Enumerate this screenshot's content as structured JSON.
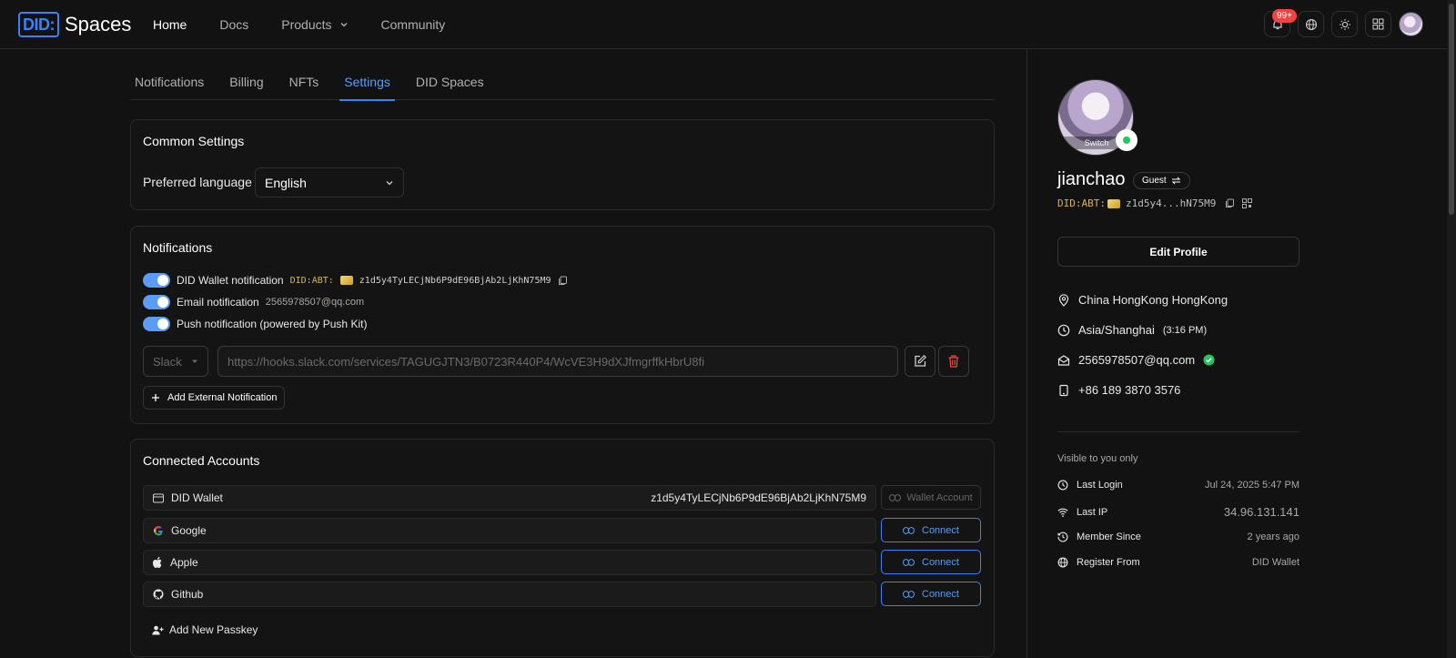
{
  "header": {
    "logo_box": "DID:",
    "logo_text": "Spaces",
    "nav": [
      {
        "label": "Home"
      },
      {
        "label": "Docs"
      },
      {
        "label": "Products"
      },
      {
        "label": "Community"
      }
    ],
    "badge": "99+"
  },
  "tabs": [
    {
      "label": "Notifications"
    },
    {
      "label": "Billing"
    },
    {
      "label": "NFTs"
    },
    {
      "label": "Settings"
    },
    {
      "label": "DID Spaces"
    }
  ],
  "common": {
    "title": "Common Settings",
    "language_label": "Preferred language",
    "language_value": "English"
  },
  "notifications": {
    "title": "Notifications",
    "wallet_label": "DID Wallet notification",
    "did_prefix": "DID:ABT:",
    "did_full": "z1d5y4TyLECjNb6P9dE96BjAb2LjKhN75M9",
    "email_label": "Email notification",
    "email_value": "2565978507@qq.com",
    "push_label": "Push notification (powered by Push Kit)",
    "channel": "Slack",
    "webhook_placeholder": "https://hooks.slack.com/services/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",
    "add_label": "Add External Notification"
  },
  "accounts": {
    "title": "Connected Accounts",
    "rows": [
      {
        "name": "DID Wallet",
        "value": "z1d5y4TyLECjNb6P9dE96BjAb2LjKhN75M9",
        "action": "Wallet Account"
      },
      {
        "name": "Google",
        "action": "Connect"
      },
      {
        "name": "Apple",
        "action": "Connect"
      },
      {
        "name": "Github",
        "action": "Connect"
      }
    ],
    "add_passkey": "Add New Passkey"
  },
  "profile": {
    "switch_label": "Switch",
    "username": "jianchao",
    "role": "Guest",
    "did_prefix": "DID:ABT:",
    "did_short": "z1d5y4...hN75M9",
    "edit_label": "Edit Profile",
    "location": "China HongKong HongKong",
    "timezone": "Asia/Shanghai",
    "local_time": "(3:16 PM)",
    "email": "2565978507@qq.com",
    "phone": "+86 189 3870 3576",
    "visibility": "Visible to you only",
    "meta": [
      {
        "label": "Last Login",
        "value": "Jul 24, 2025 5:47 PM"
      },
      {
        "label": "Last IP",
        "value": "34.96.131.141"
      },
      {
        "label": "Member Since",
        "value": "2 years ago"
      },
      {
        "label": "Register From",
        "value": "DID Wallet"
      }
    ]
  },
  "colors": {
    "accent": "#3b82f6",
    "background": "#121212",
    "did_prefix": "#d4b45a",
    "verified": "#22c55e",
    "danger": "#ef4444"
  }
}
